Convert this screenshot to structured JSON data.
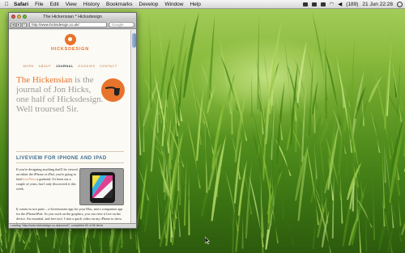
{
  "menubar": {
    "app_name": "Safari",
    "items": [
      "File",
      "Edit",
      "View",
      "History",
      "Bookmarks",
      "Develop",
      "Window",
      "Help"
    ],
    "battery": "(189)",
    "clock": "21 Jun 22:28"
  },
  "browser": {
    "window_title": "The Hickensian * Hicksdesign",
    "url": "http://www.hicksdesign.co.uk/",
    "search_placeholder": "Google",
    "status_text": "Loading \"http://www.hicksdesign.co.uk/journal/\", completed 80 of 86 items"
  },
  "site": {
    "logo_text": "HICKSDESIGN",
    "nav": [
      {
        "label": "WORK",
        "active": false
      },
      {
        "label": "ABOUT",
        "active": false
      },
      {
        "label": "JOURNAL",
        "active": true
      },
      {
        "label": "GOODIES",
        "active": false
      },
      {
        "label": "CONTACT",
        "active": false
      }
    ],
    "intro_highlight": "The Hickensian",
    "intro_rest": " is the journal of Jon Hicks, one half of Hicksdesign. Well troursed Sir.",
    "post_title": "LIVEVIEW FOR IPHONE AND IPAD",
    "para1_before": "If you're designing anything that'll be viewed on either the iPhone or iPad, you're going to find ",
    "para1_link": "LiveView",
    "para1_after": " a godsend. It's been out a couple of years, but I only discovered it this week.",
    "para2": "It comes in two parts – a Screencaster app for your Mac, and a companion app for the iPhone/iPad. As you work on the graphics, you can view it live on the device. An essential, and free tool. I shot a quick video on my iPhone to show how it"
  },
  "colors": {
    "accent": "#e8732a",
    "heading_blue": "#3a6a90",
    "intro_grey": "#9b9b9b"
  },
  "icons": {
    "apple": "apple-icon",
    "pipe": "pipe-icon",
    "spotlight": "spotlight-icon"
  }
}
